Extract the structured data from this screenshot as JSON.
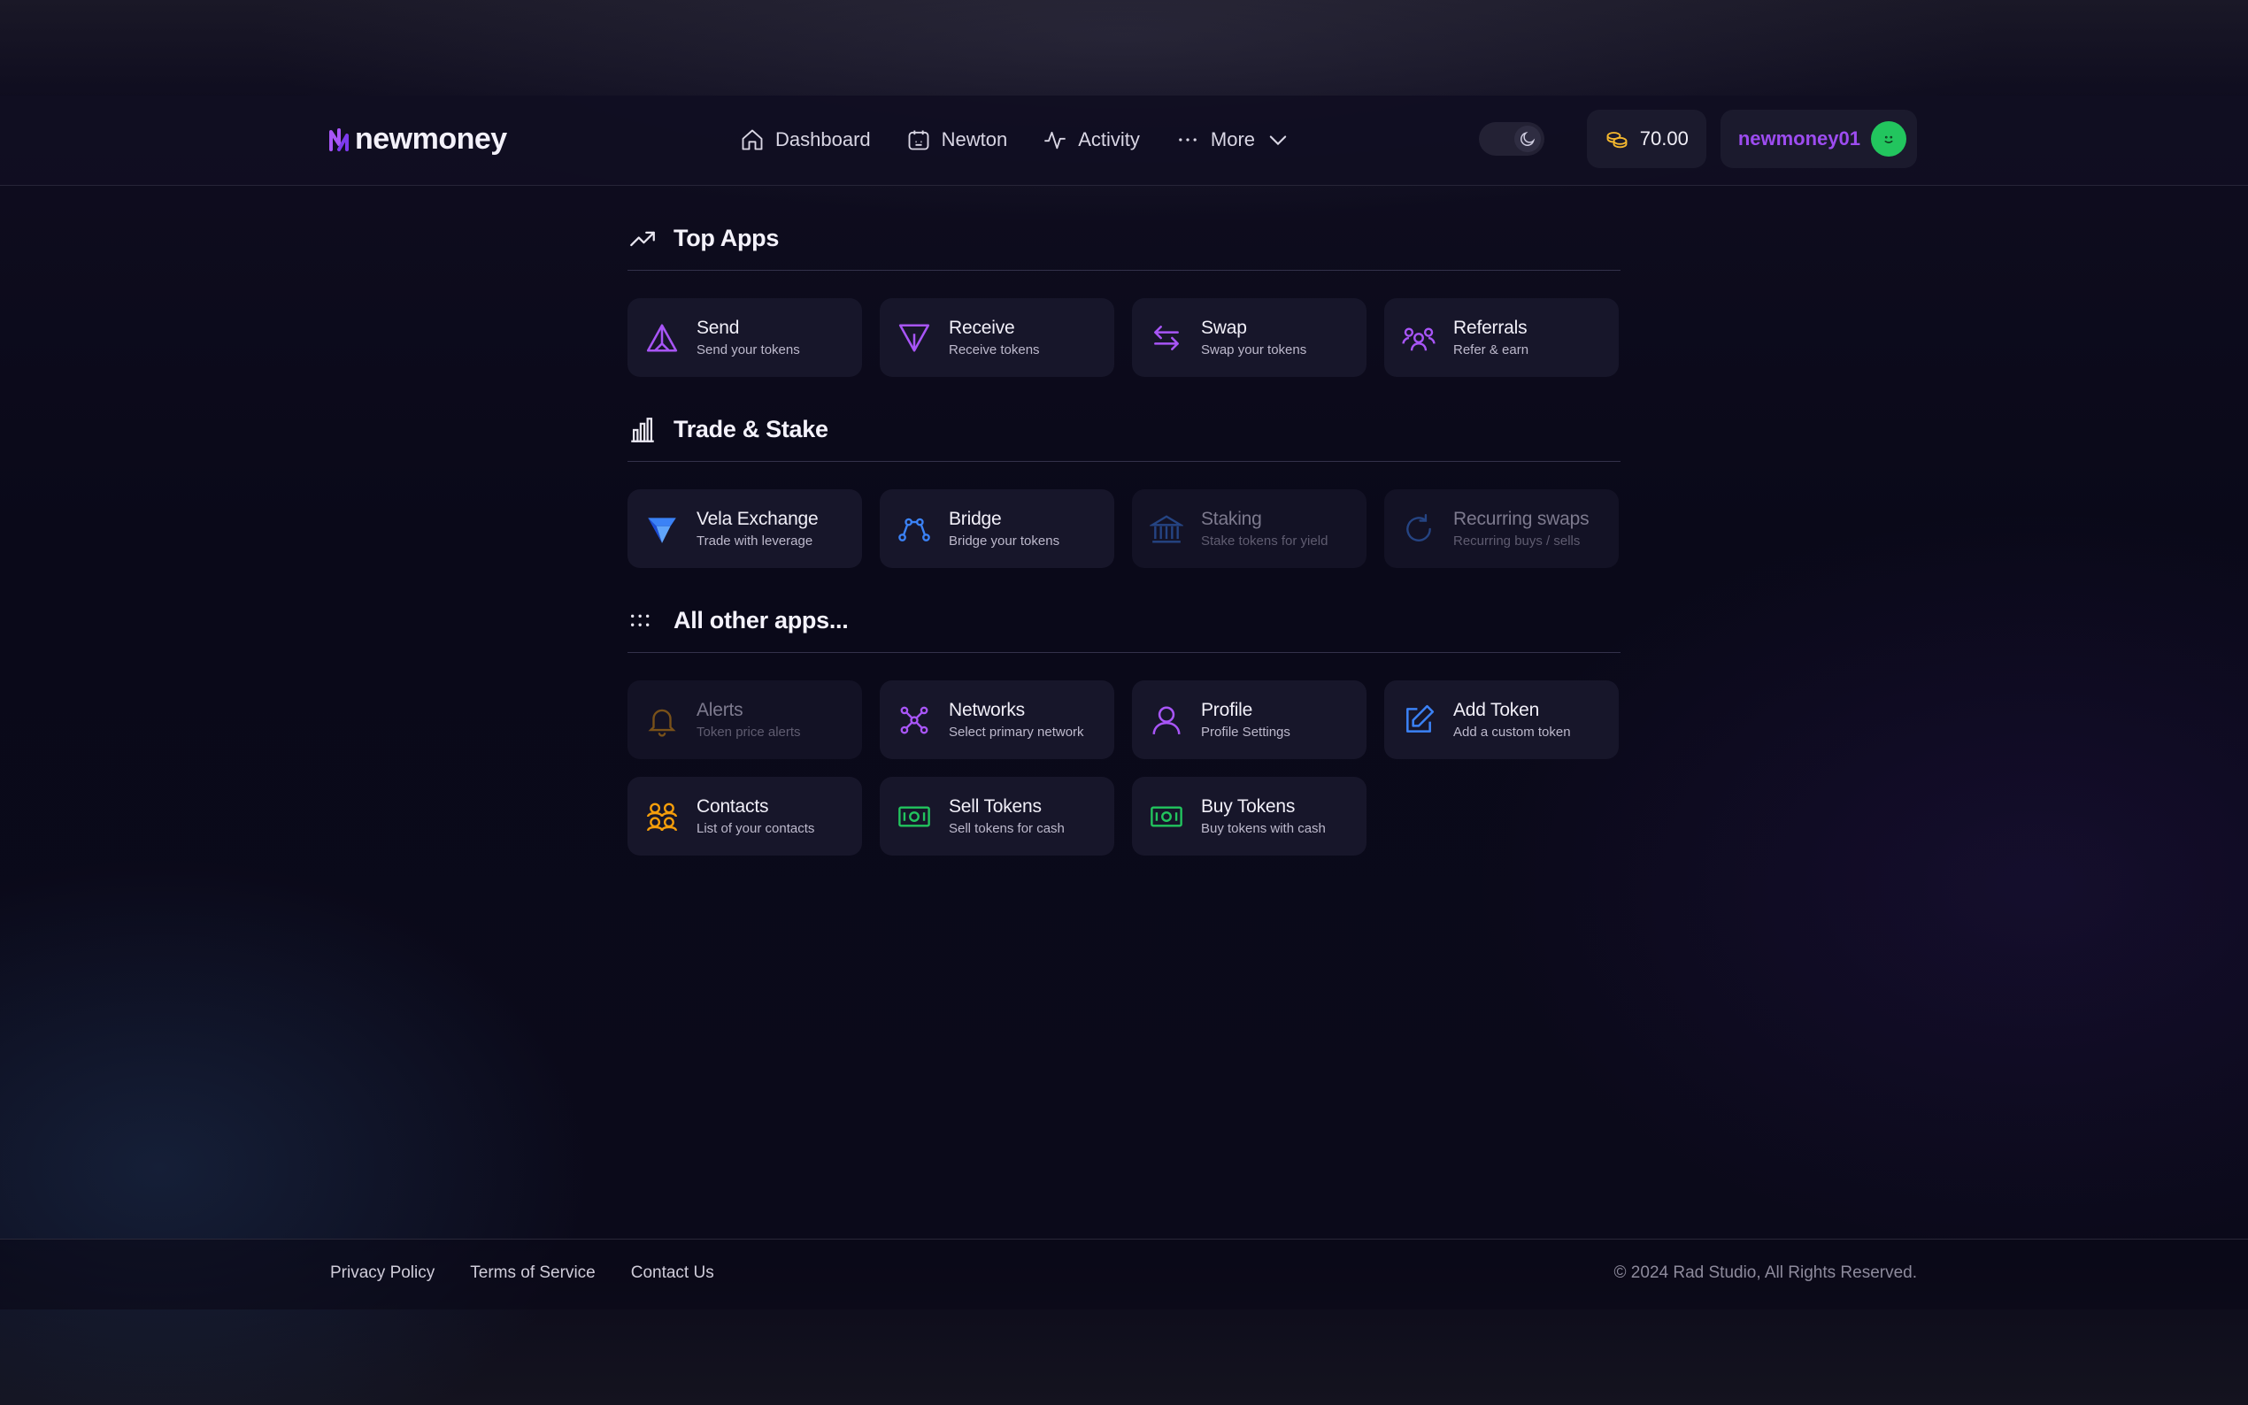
{
  "brand": {
    "name": "newmoney",
    "accent": "#9d4cf0"
  },
  "nav": {
    "links": [
      {
        "label": "Dashboard",
        "icon": "home-icon"
      },
      {
        "label": "Newton",
        "icon": "calendar-icon"
      },
      {
        "label": "Activity",
        "icon": "activity-icon"
      },
      {
        "label": "More",
        "icon": "dots-icon"
      }
    ],
    "balance": "70.00",
    "username": "newmoney01",
    "theme_icon": "moon-icon"
  },
  "sections": [
    {
      "title": "Top Apps",
      "icon": "trending-up-icon",
      "cards": [
        {
          "name": "Send",
          "desc": "Send your tokens",
          "icon": "send-icon",
          "color": "#a855f7"
        },
        {
          "name": "Receive",
          "desc": "Receive tokens",
          "icon": "receive-icon",
          "color": "#a855f7"
        },
        {
          "name": "Swap",
          "desc": "Swap your tokens",
          "icon": "swap-icon",
          "color": "#a855f7"
        },
        {
          "name": "Referrals",
          "desc": "Refer & earn",
          "icon": "users-icon",
          "color": "#a855f7"
        }
      ]
    },
    {
      "title": "Trade & Stake",
      "icon": "bar-chart-icon",
      "cards": [
        {
          "name": "Vela Exchange",
          "desc": "Trade with leverage",
          "icon": "vela-logo-icon",
          "color": "#3b82f6"
        },
        {
          "name": "Bridge",
          "desc": "Bridge your tokens",
          "icon": "bridge-icon",
          "color": "#3b82f6"
        },
        {
          "name": "Staking",
          "desc": "Stake tokens for yield",
          "icon": "bank-icon",
          "color": "#3b82f6",
          "disabled": true
        },
        {
          "name": "Recurring swaps",
          "desc": "Recurring buys / sells",
          "icon": "refresh-icon",
          "color": "#3b82f6",
          "disabled": true
        }
      ]
    },
    {
      "title": "All other apps...",
      "icon": "grid-dots-icon",
      "cards": [
        {
          "name": "Alerts",
          "desc": "Token price alerts",
          "icon": "bell-icon",
          "color": "#f59e0b",
          "disabled": true
        },
        {
          "name": "Networks",
          "desc": "Select primary network",
          "icon": "network-icon",
          "color": "#a855f7"
        },
        {
          "name": "Profile",
          "desc": "Profile Settings",
          "icon": "user-icon",
          "color": "#a855f7"
        },
        {
          "name": "Add Token",
          "desc": "Add a custom token",
          "icon": "edit-icon",
          "color": "#3b82f6"
        },
        {
          "name": "Contacts",
          "desc": "List of your contacts",
          "icon": "contacts-icon",
          "color": "#f59e0b"
        },
        {
          "name": "Sell Tokens",
          "desc": "Sell tokens for cash",
          "icon": "cash-icon",
          "color": "#22c55e"
        },
        {
          "name": "Buy Tokens",
          "desc": "Buy tokens with cash",
          "icon": "cash-icon",
          "color": "#22c55e"
        }
      ]
    }
  ],
  "footer": {
    "links": [
      "Privacy Policy",
      "Terms of Service",
      "Contact Us"
    ],
    "copyright": "© 2024 Rad Studio, All Rights Reserved."
  }
}
